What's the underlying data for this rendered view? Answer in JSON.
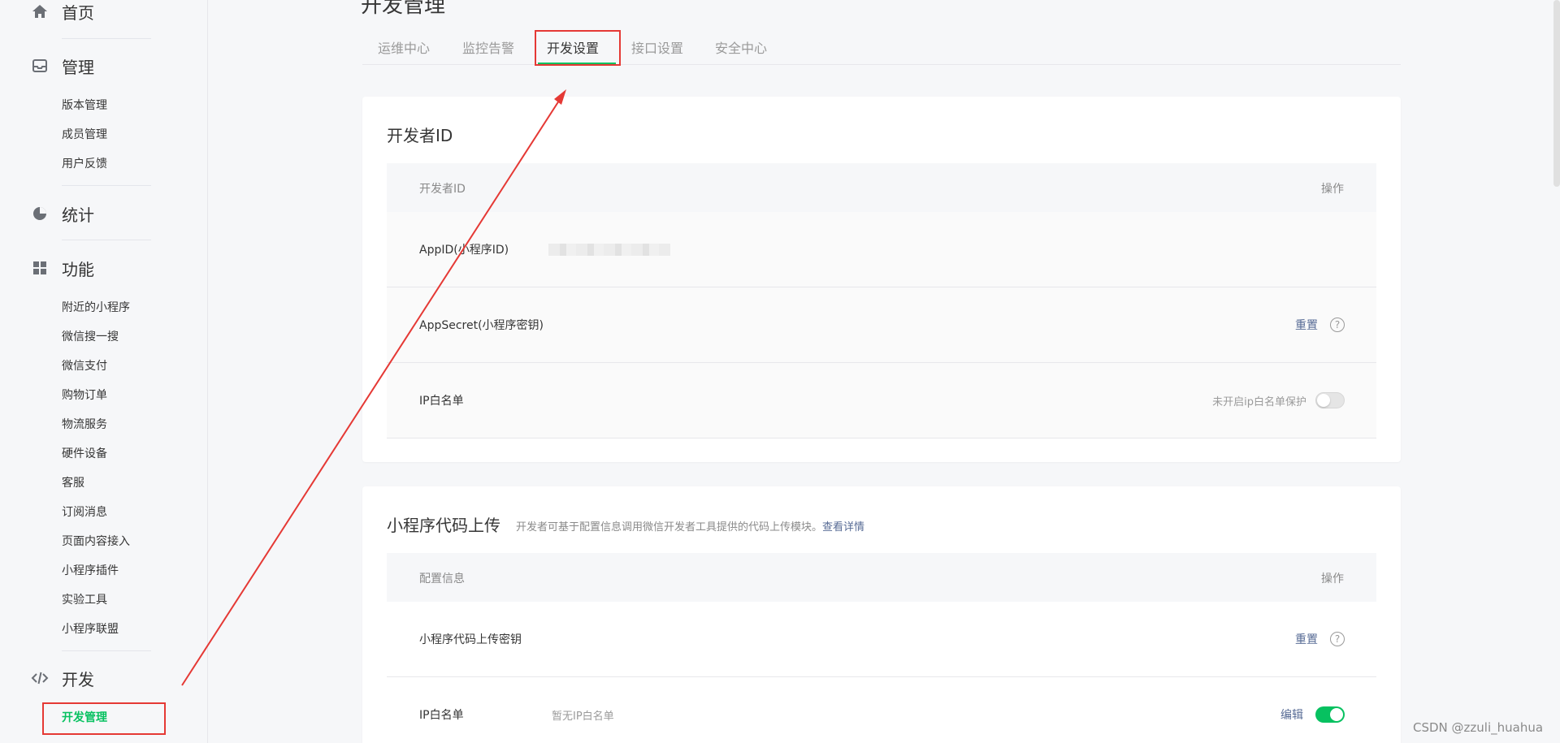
{
  "sidebar": {
    "home": "首页",
    "manage": {
      "label": "管理",
      "items": [
        "版本管理",
        "成员管理",
        "用户反馈"
      ]
    },
    "stats": "统计",
    "features": {
      "label": "功能",
      "items": [
        "附近的小程序",
        "微信搜一搜",
        "微信支付",
        "购物订单",
        "物流服务",
        "硬件设备",
        "客服",
        "订阅消息",
        "页面内容接入",
        "小程序插件",
        "实验工具",
        "小程序联盟"
      ]
    },
    "dev": {
      "label": "开发",
      "items": [
        "开发管理"
      ]
    }
  },
  "main": {
    "title": "开发管理",
    "tabs": [
      "运维中心",
      "监控告警",
      "开发设置",
      "接口设置",
      "安全中心"
    ]
  },
  "developer_id": {
    "title": "开发者ID",
    "header": {
      "col1": "开发者ID",
      "col2": "操作"
    },
    "appid_label": "AppID(小程序ID)",
    "appsecret_label": "AppSecret(小程序密钥)",
    "appsecret_action": "重置",
    "ip_label": "IP白名单",
    "ip_status": "未开启ip白名单保护"
  },
  "code_upload": {
    "title": "小程序代码上传",
    "desc": "开发者可基于配置信息调用微信开发者工具提供的代码上传模块。",
    "desc_link": "查看详情",
    "header": {
      "col1": "配置信息",
      "col2": "操作"
    },
    "key_label": "小程序代码上传密钥",
    "key_action": "重置",
    "ip_label": "IP白名单",
    "ip_value": "暂无IP白名单",
    "ip_action": "编辑"
  },
  "watermark": "CSDN @zzuli_huahua",
  "colors": {
    "accent": "#07c160",
    "link": "#576b95",
    "annotation": "#e53935"
  },
  "icons": {
    "home": "home-icon",
    "manage": "inbox-icon",
    "stats": "pie-chart-icon",
    "features": "grid-icon",
    "dev": "code-icon",
    "help": "question-circle-icon"
  }
}
